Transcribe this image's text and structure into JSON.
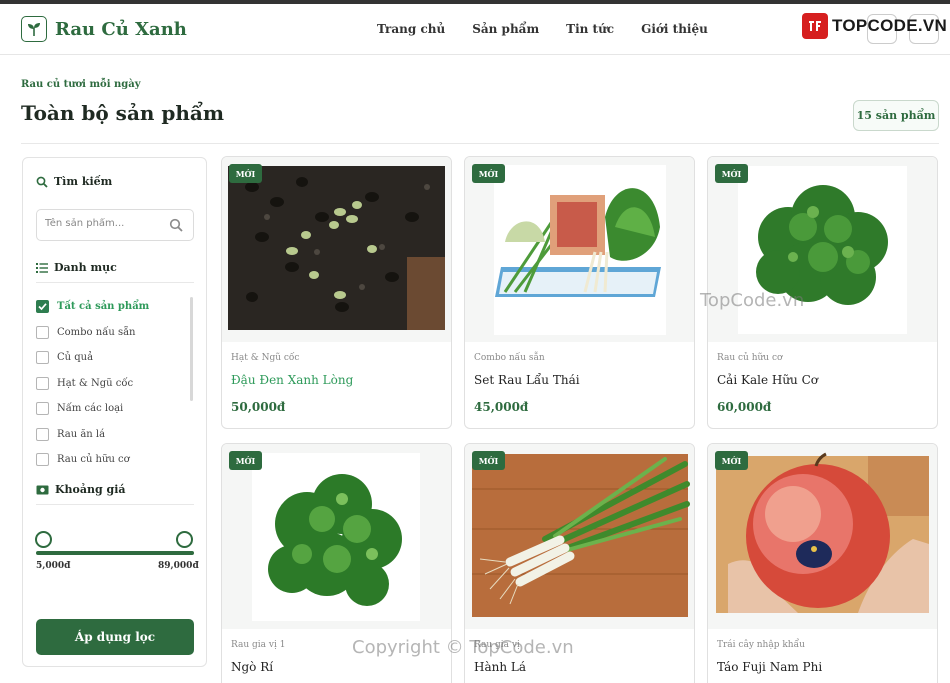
{
  "header": {
    "logo_text": "Rau Củ Xanh",
    "nav": [
      "Trang chủ",
      "Sản phẩm",
      "Tin tức",
      "Giới thiệu"
    ],
    "brand_text": "TOPCODE.VN"
  },
  "page": {
    "breadcrumb": "Rau củ tươi mỗi ngày",
    "title": "Toàn bộ sản phẩm",
    "count": "15 sản phẩm"
  },
  "sidebar": {
    "search_title": "Tìm kiếm",
    "search_placeholder": "Tên sản phẩm...",
    "category_title": "Danh mục",
    "categories": [
      {
        "label": "Tất cả sản phẩm",
        "checked": true
      },
      {
        "label": "Combo nấu sẵn",
        "checked": false
      },
      {
        "label": "Củ quả",
        "checked": false
      },
      {
        "label": "Hạt & Ngũ cốc",
        "checked": false
      },
      {
        "label": "Nấm các loại",
        "checked": false
      },
      {
        "label": "Rau ăn lá",
        "checked": false
      },
      {
        "label": "Rau củ hữu cơ",
        "checked": false
      }
    ],
    "price_title": "Khoảng giá",
    "price_min": "5,000đ",
    "price_max": "89,000đ",
    "apply_label": "Áp dụng lọc"
  },
  "products": [
    {
      "badge": "MỚI",
      "category": "Hạt & Ngũ cốc",
      "name": "Đậu Đen Xanh Lòng",
      "price": "50,000đ"
    },
    {
      "badge": "MỚI",
      "category": "Combo nấu sẵn",
      "name": "Set Rau Lẩu Thái",
      "price": "45,000đ"
    },
    {
      "badge": "MỚI",
      "category": "Rau củ hữu cơ",
      "name": "Cải Kale Hữu Cơ",
      "price": "60,000đ"
    },
    {
      "badge": "MỚI",
      "category": "Rau gia vị 1",
      "name": "Ngò Rí",
      "price": ""
    },
    {
      "badge": "MỚI",
      "category": "Rau gia vị",
      "name": "Hành Lá",
      "price": ""
    },
    {
      "badge": "MỚI",
      "category": "Trái cây nhập khẩu",
      "name": "Táo Fuji Nam Phi",
      "price": ""
    }
  ],
  "watermarks": {
    "center": "TopCode.vn",
    "footer": "Copyright © TopCode.vn"
  },
  "colors": {
    "primary": "#2e6b3f",
    "accent": "#2e9a5a",
    "brand_red": "#d61f1f"
  }
}
